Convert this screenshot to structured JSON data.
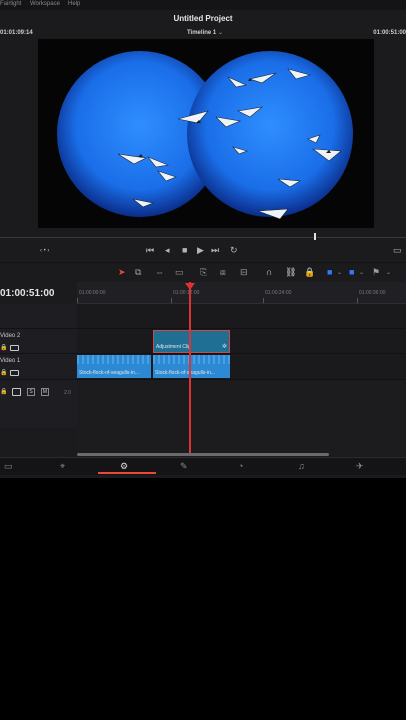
{
  "menu": {
    "items": [
      "Fairlight",
      "Workspace",
      "Help"
    ]
  },
  "project": {
    "title": "Untitled Project"
  },
  "viewer": {
    "timecode_left": "01:01:09:14",
    "timeline_name": "Timeline 1",
    "timecode_right": "01:00:51:00"
  },
  "transport": {
    "icons": [
      "dots-icon",
      "skip-start-icon",
      "prev-frame-icon",
      "stop-icon",
      "play-icon",
      "skip-end-icon",
      "loop-icon"
    ]
  },
  "timeline": {
    "current_timecode": "01:00:51:00",
    "ruler_labels": [
      "01:00:00:00",
      "01:00:12:00",
      "01:00:24:00",
      "01:00:36:00"
    ],
    "tracks": [
      {
        "name": "Video 2"
      },
      {
        "name": "Video 1"
      }
    ],
    "audio": {
      "s_label": "S",
      "m_label": "M",
      "level": "2.0"
    },
    "clips": {
      "adjustment": "Adjustment Clip",
      "video1_a": "Stock-flock-of-seagulls-in...",
      "video1_b": "Stock-flock-of-seagulls-in..."
    }
  },
  "colors": {
    "accent": "#d33333",
    "clip_blue": "#2c8ad4",
    "adjustment": "#1f6f95"
  },
  "pages": [
    "media-icon",
    "cut-icon",
    "edit-icon",
    "fusion-icon",
    "color-icon",
    "fairlight-icon",
    "deliver-icon"
  ],
  "active_page": "edit-icon"
}
